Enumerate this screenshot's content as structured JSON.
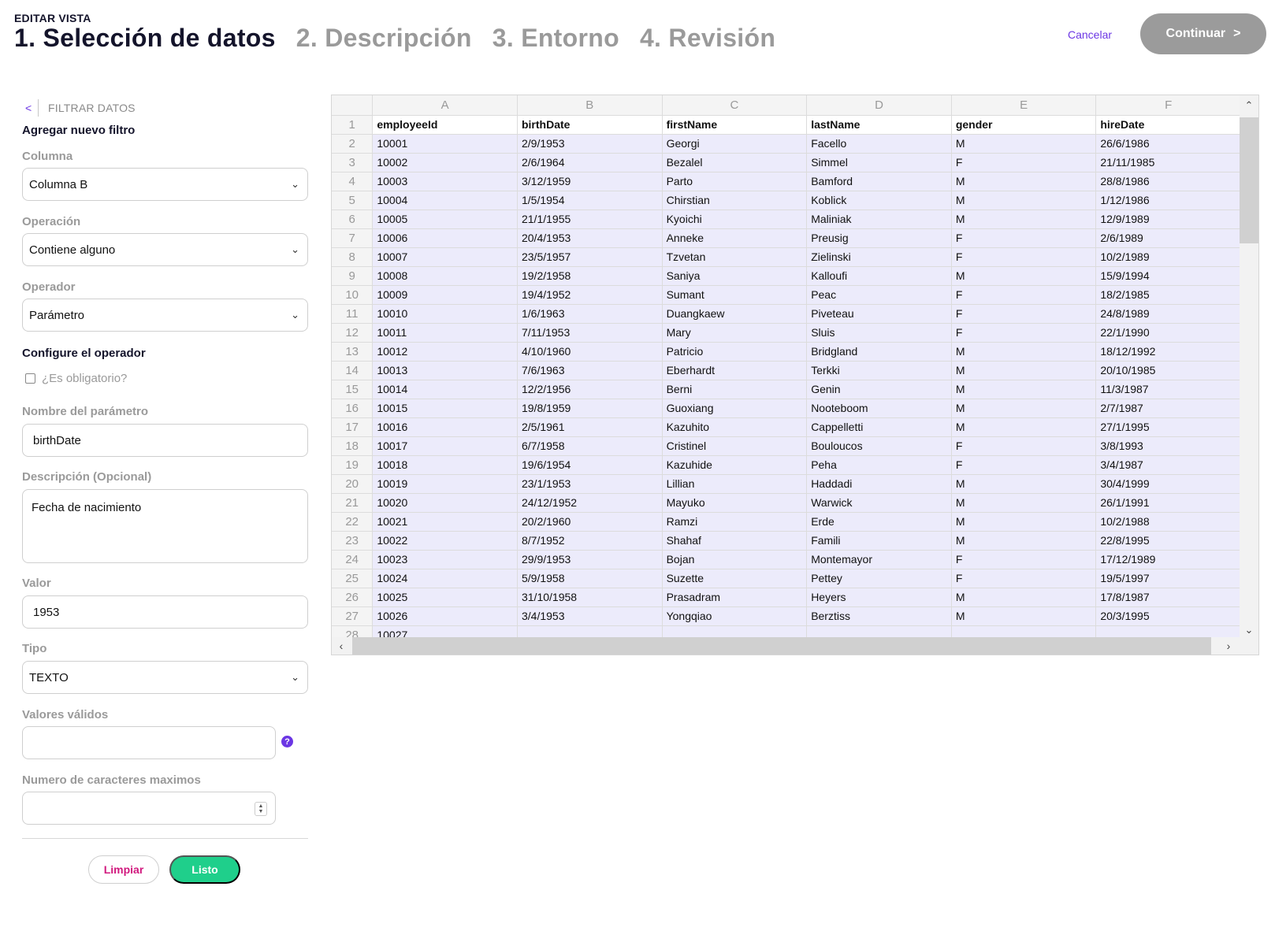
{
  "header": {
    "mode_label": "EDITAR VISTA",
    "steps": [
      {
        "label": "1. Selección de datos",
        "active": true
      },
      {
        "label": "2. Descripción",
        "active": false
      },
      {
        "label": "3. Entorno",
        "active": false
      },
      {
        "label": "4. Revisión",
        "active": false
      }
    ],
    "cancel_label": "Cancelar",
    "continue_label": "Continuar",
    "continue_arrow": ">"
  },
  "filter": {
    "back_icon": "<",
    "section_title": "FILTRAR DATOS",
    "add_filter_title": "Agregar nuevo filtro",
    "column_label": "Columna",
    "column_value": "Columna B",
    "operation_label": "Operación",
    "operation_value": "Contiene alguno",
    "operator_label": "Operador",
    "operator_value": "Parámetro",
    "configure_title": "Configure el operador",
    "required_label": "¿Es obligatorio?",
    "required_checked": false,
    "param_name_label": "Nombre del parámetro",
    "param_name_value": "birthDate",
    "description_label": "Descripción (Opcional)",
    "description_value": "Fecha de nacimiento",
    "value_label": "Valor",
    "value_value": "1953",
    "type_label": "Tipo",
    "type_value": "TEXTO",
    "valid_values_label": "Valores válidos",
    "valid_values_value": "",
    "help_icon": "?",
    "max_chars_label": "Numero de caracteres maximos",
    "max_chars_value": "",
    "clear_label": "Limpiar",
    "done_label": "Listo"
  },
  "sheet": {
    "columns": [
      "A",
      "B",
      "C",
      "D",
      "E",
      "F"
    ],
    "header_row": [
      "employeeId",
      "birthDate",
      "firstName",
      "lastName",
      "gender",
      "hireDate"
    ],
    "rows": [
      [
        "10001",
        "2/9/1953",
        "Georgi",
        "Facello",
        "M",
        "26/6/1986"
      ],
      [
        "10002",
        "2/6/1964",
        "Bezalel",
        "Simmel",
        "F",
        "21/11/1985"
      ],
      [
        "10003",
        "3/12/1959",
        "Parto",
        "Bamford",
        "M",
        "28/8/1986"
      ],
      [
        "10004",
        "1/5/1954",
        "Chirstian",
        "Koblick",
        "M",
        "1/12/1986"
      ],
      [
        "10005",
        "21/1/1955",
        "Kyoichi",
        "Maliniak",
        "M",
        "12/9/1989"
      ],
      [
        "10006",
        "20/4/1953",
        "Anneke",
        "Preusig",
        "F",
        "2/6/1989"
      ],
      [
        "10007",
        "23/5/1957",
        "Tzvetan",
        "Zielinski",
        "F",
        "10/2/1989"
      ],
      [
        "10008",
        "19/2/1958",
        "Saniya",
        "Kalloufi",
        "M",
        "15/9/1994"
      ],
      [
        "10009",
        "19/4/1952",
        "Sumant",
        "Peac",
        "F",
        "18/2/1985"
      ],
      [
        "10010",
        "1/6/1963",
        "Duangkaew",
        "Piveteau",
        "F",
        "24/8/1989"
      ],
      [
        "10011",
        "7/11/1953",
        "Mary",
        "Sluis",
        "F",
        "22/1/1990"
      ],
      [
        "10012",
        "4/10/1960",
        "Patricio",
        "Bridgland",
        "M",
        "18/12/1992"
      ],
      [
        "10013",
        "7/6/1963",
        "Eberhardt",
        "Terkki",
        "M",
        "20/10/1985"
      ],
      [
        "10014",
        "12/2/1956",
        "Berni",
        "Genin",
        "M",
        "11/3/1987"
      ],
      [
        "10015",
        "19/8/1959",
        "Guoxiang",
        "Nooteboom",
        "M",
        "2/7/1987"
      ],
      [
        "10016",
        "2/5/1961",
        "Kazuhito",
        "Cappelletti",
        "M",
        "27/1/1995"
      ],
      [
        "10017",
        "6/7/1958",
        "Cristinel",
        "Bouloucos",
        "F",
        "3/8/1993"
      ],
      [
        "10018",
        "19/6/1954",
        "Kazuhide",
        "Peha",
        "F",
        "3/4/1987"
      ],
      [
        "10019",
        "23/1/1953",
        "Lillian",
        "Haddadi",
        "M",
        "30/4/1999"
      ],
      [
        "10020",
        "24/12/1952",
        "Mayuko",
        "Warwick",
        "M",
        "26/1/1991"
      ],
      [
        "10021",
        "20/2/1960",
        "Ramzi",
        "Erde",
        "M",
        "10/2/1988"
      ],
      [
        "10022",
        "8/7/1952",
        "Shahaf",
        "Famili",
        "M",
        "22/8/1995"
      ],
      [
        "10023",
        "29/9/1953",
        "Bojan",
        "Montemayor",
        "F",
        "17/12/1989"
      ],
      [
        "10024",
        "5/9/1958",
        "Suzette",
        "Pettey",
        "F",
        "19/5/1997"
      ],
      [
        "10025",
        "31/10/1958",
        "Prasadram",
        "Heyers",
        "M",
        "17/8/1987"
      ],
      [
        "10026",
        "3/4/1953",
        "Yongqiao",
        "Berztiss",
        "M",
        "20/3/1995"
      ],
      [
        "10027",
        "",
        "",
        "",
        "",
        ""
      ]
    ]
  },
  "colors": {
    "accent": "#6b36e4",
    "row_highlight": "#ecebfb",
    "done_button": "#1fcf8b",
    "clear_text": "#d1197e",
    "continue_button": "#9b9b9b"
  },
  "icons": [
    "back-chevron-icon",
    "chevron-down-icon",
    "help-icon",
    "stepper-icon",
    "scroll-up-icon",
    "scroll-down-icon",
    "scroll-left-icon",
    "scroll-right-icon"
  ]
}
